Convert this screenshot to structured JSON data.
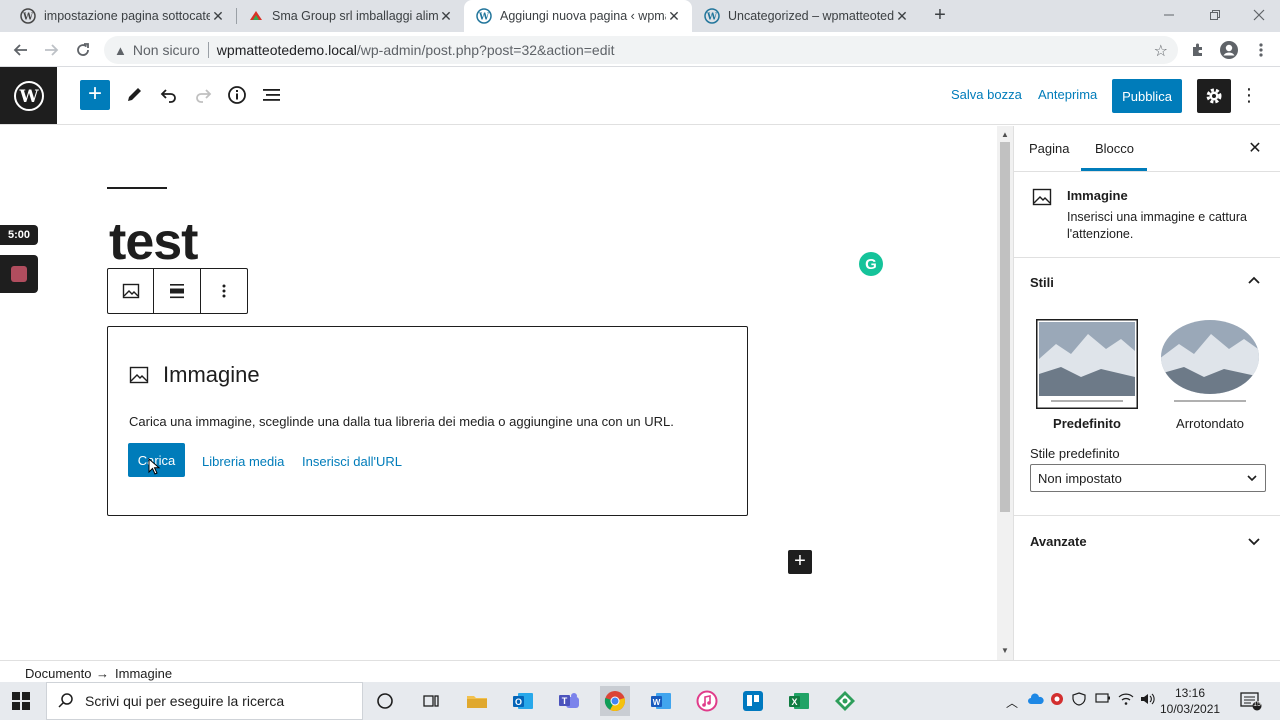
{
  "browser": {
    "tabs": [
      {
        "title": "impostazione pagina sottocateg",
        "active": false,
        "favicon": "wordpress-icon"
      },
      {
        "title": "Sma Group srl imballaggi alimen",
        "active": false,
        "favicon": "sma-group-icon"
      },
      {
        "title": "Aggiungi nuova pagina ‹ wpmatt",
        "active": true,
        "favicon": "wordpress-icon"
      },
      {
        "title": "Uncategorized – wpmatteotedem",
        "active": false,
        "favicon": "wordpress-icon"
      }
    ],
    "security_label": "Non sicuro",
    "url_host": "wpmatteotedemo.local",
    "url_path": "/wp-admin/post.php?post=32&action=edit"
  },
  "wp_header": {
    "save_draft": "Salva bozza",
    "preview": "Anteprima",
    "publish": "Pubblica"
  },
  "editor": {
    "timer": "5:00",
    "post_title": "test",
    "placeholder": {
      "title": "Immagine",
      "instructions": "Carica una immagine, sceglinde una dalla tua libreria dei media o aggiungine una con un URL.",
      "upload_label": "Carica",
      "media_library_label": "Libreria media",
      "insert_url_label": "Inserisci dall'URL"
    }
  },
  "sidebar": {
    "tab_page": "Pagina",
    "tab_block": "Blocco",
    "block_name": "Immagine",
    "block_description": "Inserisci una immagine e cattura l'attenzione.",
    "styles_title": "Stili",
    "style_default": "Predefinito",
    "style_rounded": "Arrotondato",
    "default_style_label": "Stile predefinito",
    "default_style_value": "Non impostato",
    "advanced_title": "Avanzate"
  },
  "breadcrumb": {
    "root": "Documento",
    "arrow": "→",
    "current": "Immagine"
  },
  "taskbar": {
    "search_placeholder": "Scrivi qui per eseguire la ricerca",
    "time": "13:16",
    "date": "10/03/2021",
    "notification_count": "15"
  },
  "colors": {
    "wp_blue": "#007cba",
    "wp_dark": "#1e1e1e",
    "grammarly": "#15c39a"
  }
}
